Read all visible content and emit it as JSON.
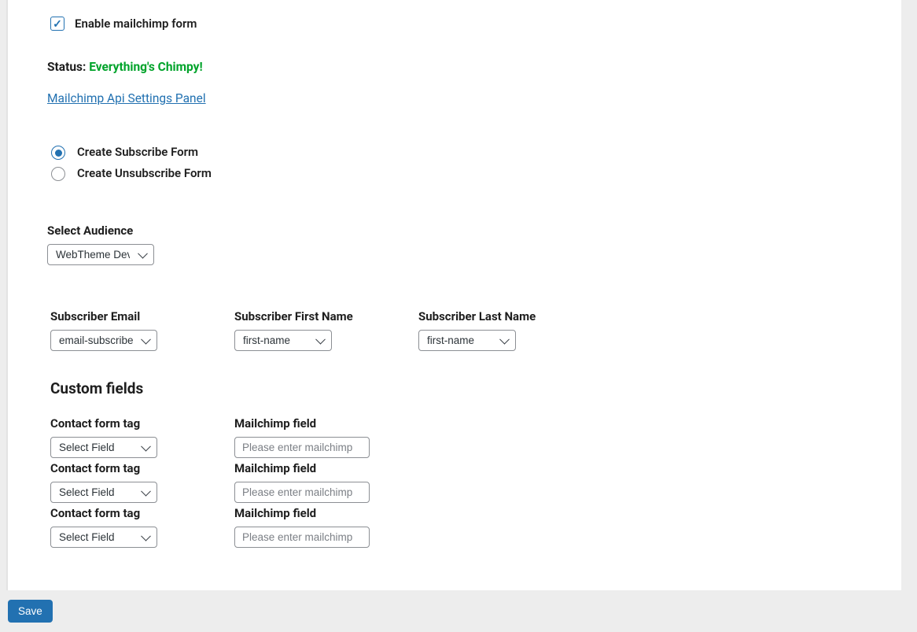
{
  "enable": {
    "label": "Enable mailchimp form",
    "checked": true
  },
  "status": {
    "label": "Status: ",
    "value": "Everything's Chimpy!"
  },
  "api_link": "Mailchimp Api Settings Panel",
  "form_type": {
    "subscribe": "Create Subscribe Form",
    "unsubscribe": "Create Unsubscribe Form",
    "selected": "subscribe"
  },
  "audience": {
    "label": "Select Audience",
    "value": "WebTheme Dev"
  },
  "subscriber_fields": {
    "email": {
      "label": "Subscriber Email",
      "value": "email-subscribe"
    },
    "first_name": {
      "label": "Subscriber First Name",
      "value": "first-name"
    },
    "last_name": {
      "label": "Subscriber Last Name",
      "value": "first-name"
    }
  },
  "custom_fields": {
    "title": "Custom fields",
    "tag_label": "Contact form tag",
    "field_label": "Mailchimp field",
    "select_placeholder": "Select Field",
    "input_placeholder": "Please enter mailchimp",
    "rows": [
      {
        "tag": "Select Field",
        "field": ""
      },
      {
        "tag": "Select Field",
        "field": ""
      },
      {
        "tag": "Select Field",
        "field": ""
      }
    ]
  },
  "save_label": "Save"
}
